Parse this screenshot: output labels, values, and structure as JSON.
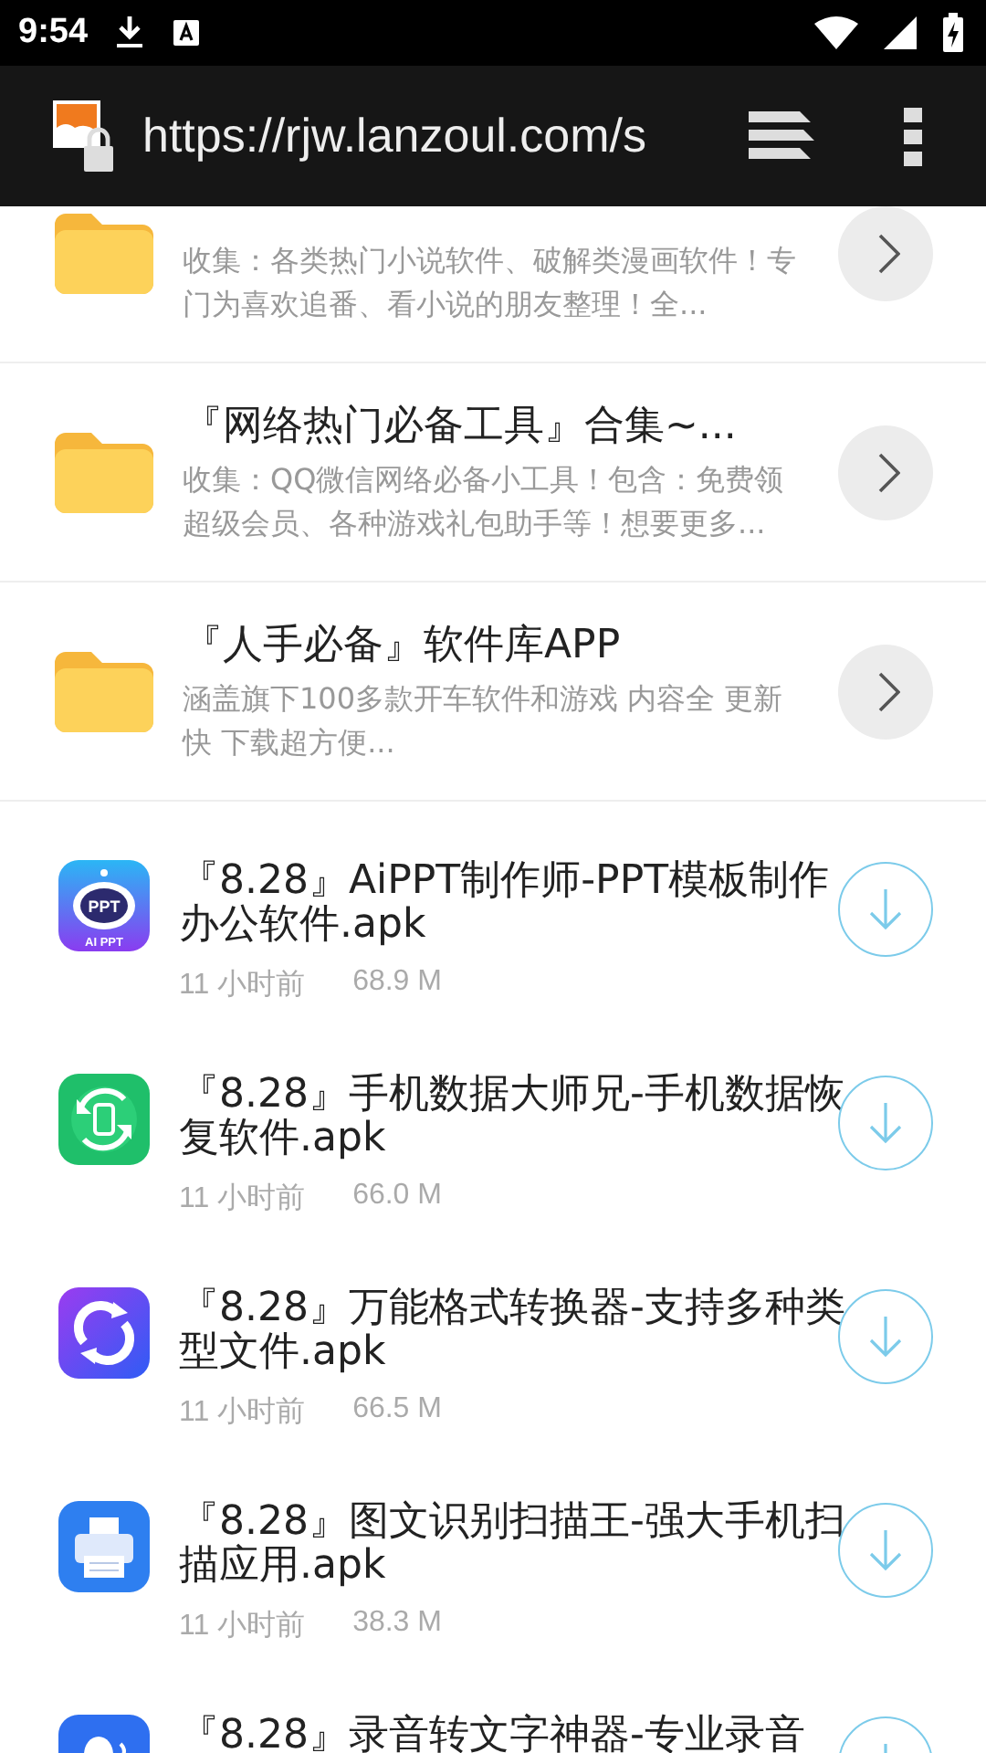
{
  "status_bar": {
    "time": "9:54"
  },
  "toolbar": {
    "url": "https://rjw.lanzoul.com/s"
  },
  "folders": [
    {
      "description": "收集：各类热门小说软件、破解类漫画软件！专门为喜欢追番、看小说的朋友整理！全..."
    },
    {
      "title": "『网络热门必备工具』合集~...",
      "description": "收集：QQ微信网络必备小工具！包含：免费领超级会员、各种游戏礼包助手等！想要更多..."
    },
    {
      "title": "『人手必备』软件库APP",
      "description": "涵盖旗下100多款开车软件和游戏 内容全 更新快 下载超方便..."
    }
  ],
  "files": [
    {
      "kind": "ppt",
      "icon_label": "PPT",
      "icon_caption": "AI PPT",
      "title": "『8.28』AiPPT制作师-PPT模板制作办公软件.apk",
      "time": "11 小时前",
      "size": "68.9 M"
    },
    {
      "kind": "recover",
      "title": "『8.28』手机数据大师兄-手机数据恢复软件.apk",
      "time": "11 小时前",
      "size": "66.0 M"
    },
    {
      "kind": "convert",
      "title": "『8.28』万能格式转换器-支持多种类型文件.apk",
      "time": "11 小时前",
      "size": "66.5 M"
    },
    {
      "kind": "scanner",
      "title": "『8.28』图文识别扫描王-强大手机扫描应用.apk",
      "time": "11 小时前",
      "size": "38.3 M"
    },
    {
      "kind": "recorder",
      "title": "『8.28』录音转文字神器-专业录音"
    }
  ]
}
